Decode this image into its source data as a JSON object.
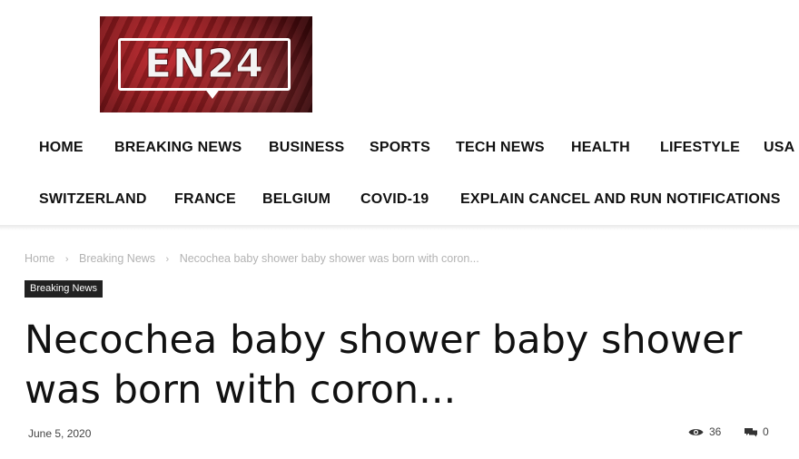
{
  "logo": {
    "text": "EN24"
  },
  "nav": {
    "row1": [
      "HOME",
      "BREAKING NEWS",
      "BUSINESS",
      "SPORTS",
      "TECH NEWS",
      "HEALTH",
      "LIFESTYLE",
      "USA"
    ],
    "row2": [
      "SWITZERLAND",
      "FRANCE",
      "BELGIUM",
      "COVID-19",
      "EXPLAIN CANCEL AND RUN NOTIFICATIONS"
    ]
  },
  "breadcrumb": {
    "home": "Home",
    "category": "Breaking News",
    "current": "Necochea baby shower baby shower was born with coron..."
  },
  "article": {
    "category_badge": "Breaking News",
    "title": "Necochea baby shower baby shower was born with coron...",
    "date": "June 5, 2020",
    "views": "36",
    "comments": "0"
  },
  "colors": {
    "logo_red": "#8e1a1e",
    "badge_bg": "#222222",
    "breadcrumb_text": "#b3b3b3"
  },
  "icons": {
    "views": "eye-icon",
    "comments": "comment-icon"
  }
}
